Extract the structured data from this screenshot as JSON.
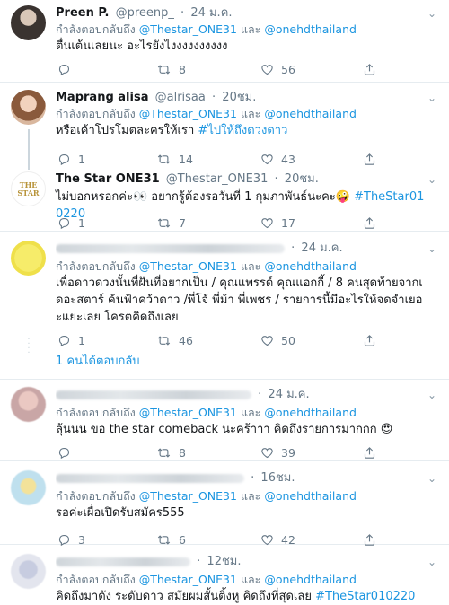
{
  "tweets": [
    {
      "name": "Preen P.",
      "handle": "@preenp_",
      "time": "24 ม.ค.",
      "reply_prefix": "กำลังตอบกลับถึง",
      "reply_to_1": "@Thestar_ONE31",
      "reply_and": "และ",
      "reply_to_2": "@onehdthailand",
      "text": "ตื่นเต้นเลยนะ อะไรยังไงงงงงงงงงง",
      "stats": {
        "replies": "",
        "retweets": "8",
        "likes": "56"
      }
    },
    {
      "name": "Maprang alisa",
      "handle": "@alrisaa",
      "time": "20ชม.",
      "reply_prefix": "กำลังตอบกลับถึง",
      "reply_to_1": "@Thestar_ONE31",
      "reply_and": "และ",
      "reply_to_2": "@onehdthailand",
      "text": "หรือเค้าโปรโมตละครให้เรา",
      "hashtag": "#ไปให้ถึงดวงดาว",
      "stats": {
        "replies": "1",
        "retweets": "14",
        "likes": "43"
      }
    },
    {
      "name": "The Star ONE31",
      "handle": "@Thestar_ONE31",
      "time": "20ชม.",
      "avatar_text": "THE STAR",
      "text": "ไม่บอกหรอกค่ะ👀 อยากรู้ต้องรอวันที่ 1 กุมภาพันธ์นะคะ🤪",
      "hashtag": "#TheStar010220",
      "stats": {
        "replies": "1",
        "retweets": "7",
        "likes": "17"
      }
    },
    {
      "time": "24 ม.ค.",
      "reply_prefix": "กำลังตอบกลับถึง",
      "reply_to_1": "@Thestar_ONE31",
      "reply_and": "และ",
      "reply_to_2": "@onehdthailand",
      "text": "เพื่อดาวดวงนั้นที่ฝันที่อยากเป็น / คุณแพรรด์ คุณแอกกี้ / 8 คนสุดท้ายจากเดอะสตาร์ ค้นฟ้าคว้าดาว /พี่โจ้ พี่ม้า พี่เพชร / รายการนี้มีอะไรให้จดจำเยอะแยะเลย โครตคิดถึงเลย",
      "stats": {
        "replies": "1",
        "retweets": "46",
        "likes": "50"
      },
      "show_replies": "1 คนได้ตอบกลับ"
    },
    {
      "time": "24 ม.ค.",
      "reply_prefix": "กำลังตอบกลับถึง",
      "reply_to_1": "@Thestar_ONE31",
      "reply_and": "และ",
      "reply_to_2": "@onehdthailand",
      "text": "ลุ้นนน ขอ the star comeback นะคร้าาา คิดถึงรายการมากกก 😍",
      "stats": {
        "replies": "",
        "retweets": "8",
        "likes": "39"
      }
    },
    {
      "time": "16ชม.",
      "reply_prefix": "กำลังตอบกลับถึง",
      "reply_to_1": "@Thestar_ONE31",
      "reply_and": "และ",
      "reply_to_2": "@onehdthailand",
      "text": "รอค่ะเผื่อเปิดรับสมัคร555",
      "stats": {
        "replies": "3",
        "retweets": "6",
        "likes": "42"
      }
    },
    {
      "time": "12ชม.",
      "reply_prefix": "กำลังตอบกลับถึง",
      "reply_to_1": "@Thestar_ONE31",
      "reply_and": "และ",
      "reply_to_2": "@onehdthailand",
      "text": "คิดถึงมาดัง ระดับดาว สมัยผมสั้นติ้งหู คิดถึงที่สุดเลย",
      "hashtag": "#TheStar010220"
    }
  ],
  "colors": {
    "link": "#1b95e0",
    "muted": "#657786",
    "border": "#e6ecf0",
    "text": "#14171a"
  },
  "icons": [
    "reply-icon",
    "retweet-icon",
    "like-icon",
    "share-icon",
    "caret-down-icon"
  ]
}
